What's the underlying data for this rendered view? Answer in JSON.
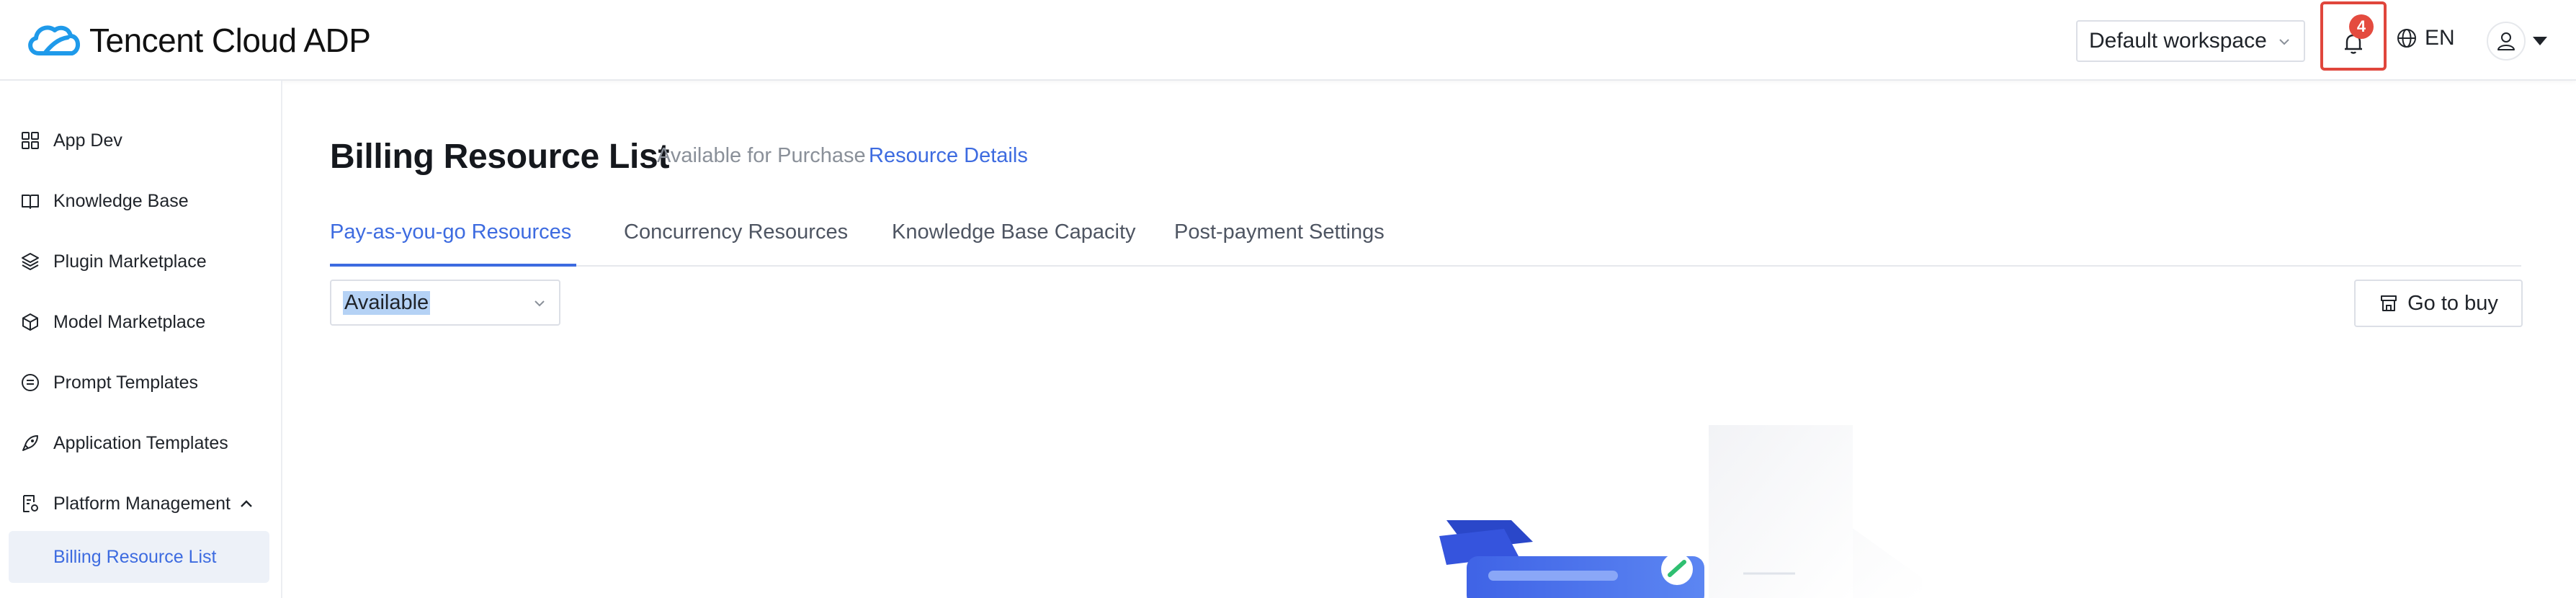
{
  "header": {
    "logo_text": "Tencent Cloud ADP",
    "workspace": "Default workspace",
    "notification_count": "4",
    "language": "EN"
  },
  "sidebar": {
    "items": [
      {
        "label": "App Dev",
        "icon": "grid-icon"
      },
      {
        "label": "Knowledge Base",
        "icon": "book-icon"
      },
      {
        "label": "Plugin Marketplace",
        "icon": "layers-icon"
      },
      {
        "label": "Model Marketplace",
        "icon": "cube-icon"
      },
      {
        "label": "Prompt Templates",
        "icon": "message-icon"
      },
      {
        "label": "Application Templates",
        "icon": "rocket-icon"
      },
      {
        "label": "Platform Management",
        "icon": "document-gear-icon",
        "expanded": true
      }
    ],
    "sub_items": [
      {
        "label": "Billing Resource List",
        "selected": true
      }
    ]
  },
  "main": {
    "title": "Billing Resource List",
    "subtitle": "Available for Purchase",
    "subtitle_link": "Resource Details",
    "tabs": [
      {
        "label": "Pay-as-you-go Resources",
        "active": true
      },
      {
        "label": "Concurrency Resources",
        "active": false
      },
      {
        "label": "Knowledge Base Capacity",
        "active": false
      },
      {
        "label": "Post-payment Settings",
        "active": false
      }
    ],
    "filter_value": "Available",
    "buy_button": "Go to buy"
  },
  "colors": {
    "accent": "#3d6be0",
    "badge": "#e44b3f",
    "highlight_border": "#e0463c",
    "selected_bg": "#edf1f8"
  }
}
